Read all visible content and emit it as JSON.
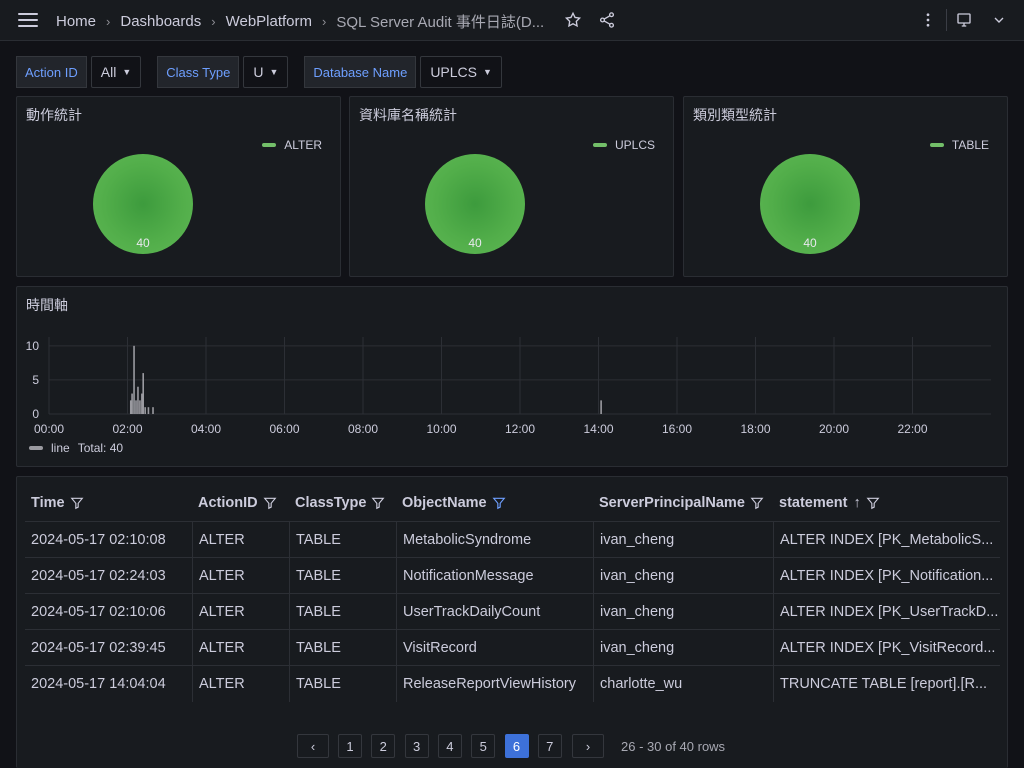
{
  "breadcrumb": {
    "home": "Home",
    "dashboards": "Dashboards",
    "folder": "WebPlatform",
    "current": "SQL Server Audit 事件日誌(D..."
  },
  "icons": {
    "menu": "hamburger-menu-icon",
    "star": "star-icon",
    "share": "share-icon",
    "more": "more-vertical-icon",
    "monitor": "monitor-icon",
    "chevron": "chevron-down-icon"
  },
  "variables": [
    {
      "label": "Action ID",
      "value": "All"
    },
    {
      "label": "Class Type",
      "value": "U"
    },
    {
      "label": "Database Name",
      "value": "UPLCS"
    }
  ],
  "stat_panels": [
    {
      "title": "動作統計",
      "legend": "ALTER",
      "value": "40"
    },
    {
      "title": "資料庫名稱統計",
      "legend": "UPLCS",
      "value": "40"
    },
    {
      "title": "類別類型統計",
      "legend": "TABLE",
      "value": "40"
    }
  ],
  "colors": {
    "pie_green": "#5fb855",
    "accent_blue": "#6e9fff",
    "active_page": "#3d71d9"
  },
  "timeline": {
    "title": "時間軸",
    "legend_name": "line",
    "legend_total": "Total: 40",
    "y_ticks": [
      "10",
      "5",
      "0"
    ],
    "x_ticks": [
      "00:00",
      "02:00",
      "04:00",
      "06:00",
      "08:00",
      "10:00",
      "12:00",
      "14:00",
      "16:00",
      "18:00",
      "20:00",
      "22:00"
    ]
  },
  "chart_data": {
    "type": "bar",
    "xlabel": "",
    "ylabel": "",
    "ylim": [
      0,
      11
    ],
    "xlim_hours": [
      0,
      24
    ],
    "grid": true,
    "legend_placement": "bottom-left",
    "series": [
      {
        "name": "line",
        "points": [
          {
            "t": "02:05",
            "v": 2
          },
          {
            "t": "02:07",
            "v": 3
          },
          {
            "t": "02:10",
            "v": 10
          },
          {
            "t": "02:13",
            "v": 2
          },
          {
            "t": "02:16",
            "v": 4
          },
          {
            "t": "02:19",
            "v": 2
          },
          {
            "t": "02:22",
            "v": 3
          },
          {
            "t": "02:24",
            "v": 6
          },
          {
            "t": "02:27",
            "v": 1
          },
          {
            "t": "02:32",
            "v": 1
          },
          {
            "t": "02:39",
            "v": 1
          },
          {
            "t": "14:04",
            "v": 2
          }
        ]
      }
    ]
  },
  "table": {
    "columns": [
      "Time",
      "ActionID",
      "ClassType",
      "ObjectName",
      "ServerPrincipalName",
      "statement"
    ],
    "rows": [
      [
        "2024-05-17 02:10:08",
        "ALTER",
        "TABLE",
        "MetabolicSyndrome",
        "ivan_cheng",
        "ALTER INDEX [PK_MetabolicS..."
      ],
      [
        "2024-05-17 02:24:03",
        "ALTER",
        "TABLE",
        "NotificationMessage",
        "ivan_cheng",
        "ALTER INDEX [PK_Notification..."
      ],
      [
        "2024-05-17 02:10:06",
        "ALTER",
        "TABLE",
        "UserTrackDailyCount",
        "ivan_cheng",
        "ALTER INDEX [PK_UserTrackD..."
      ],
      [
        "2024-05-17 02:39:45",
        "ALTER",
        "TABLE",
        "VisitRecord",
        "ivan_cheng",
        "ALTER INDEX [PK_VisitRecord..."
      ],
      [
        "2024-05-17 14:04:04",
        "ALTER",
        "TABLE",
        "ReleaseReportViewHistory",
        "charlotte_wu",
        "TRUNCATE TABLE [report].[R..."
      ]
    ]
  },
  "pagination": {
    "pages": [
      "1",
      "2",
      "3",
      "4",
      "5",
      "6",
      "7"
    ],
    "active": "6",
    "prev": "‹",
    "next": "›",
    "info": "26 - 30 of 40 rows"
  }
}
